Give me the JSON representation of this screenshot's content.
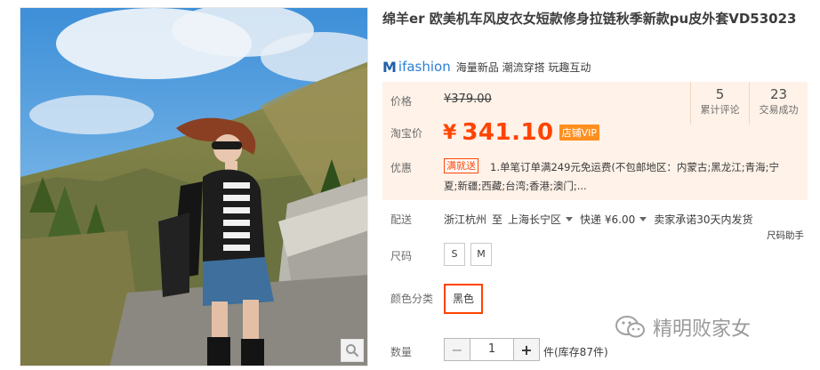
{
  "product": {
    "title": "绵羊er 欧美机车风皮衣女短款修身拉链秋季新款pu皮外套VD53023"
  },
  "brand": {
    "logo_text": "ifashion",
    "slogan": "海量新品 潮流穿搭 玩趣互动"
  },
  "price": {
    "label": "价格",
    "original": "¥379.00",
    "promo_label": "淘宝价",
    "currency": "¥",
    "promo_value": "341.10",
    "vip_badge": "店铺VIP"
  },
  "stats": [
    {
      "value": "5",
      "label": "累计评论"
    },
    {
      "value": "23",
      "label": "交易成功"
    }
  ],
  "promotion": {
    "label": "优惠",
    "badge": "满就送",
    "text_line1": "1.单笔订单满249元免运费(不包邮地区：内蒙古;黑龙江;青海;宁",
    "text_line2": "夏;新疆;西藏;台湾;香港;澳门;..."
  },
  "delivery": {
    "label": "配送",
    "from": "浙江杭州",
    "to_word": "至",
    "to": "上海长宁区",
    "method": "快递 ¥6.00",
    "promise": "卖家承诺30天内发货",
    "size_helper": "尺码助手"
  },
  "size": {
    "label": "尺码",
    "options": [
      "S",
      "M"
    ]
  },
  "color": {
    "label": "颜色分类",
    "selected": "黑色"
  },
  "quantity": {
    "label": "数量",
    "minus": "−",
    "value": "1",
    "plus": "+",
    "stock": "件(库存87件)"
  },
  "watermark": {
    "text": "精明败家女"
  },
  "colors": {
    "accent": "#ff4400",
    "panel_bg": "#fff2e8",
    "vip": "#ff8f1f",
    "brand_blue": "#2a7fd4"
  },
  "icons": [
    "zoom-icon",
    "brand-m-icon",
    "caret-down-icon",
    "wechat-icon"
  ]
}
